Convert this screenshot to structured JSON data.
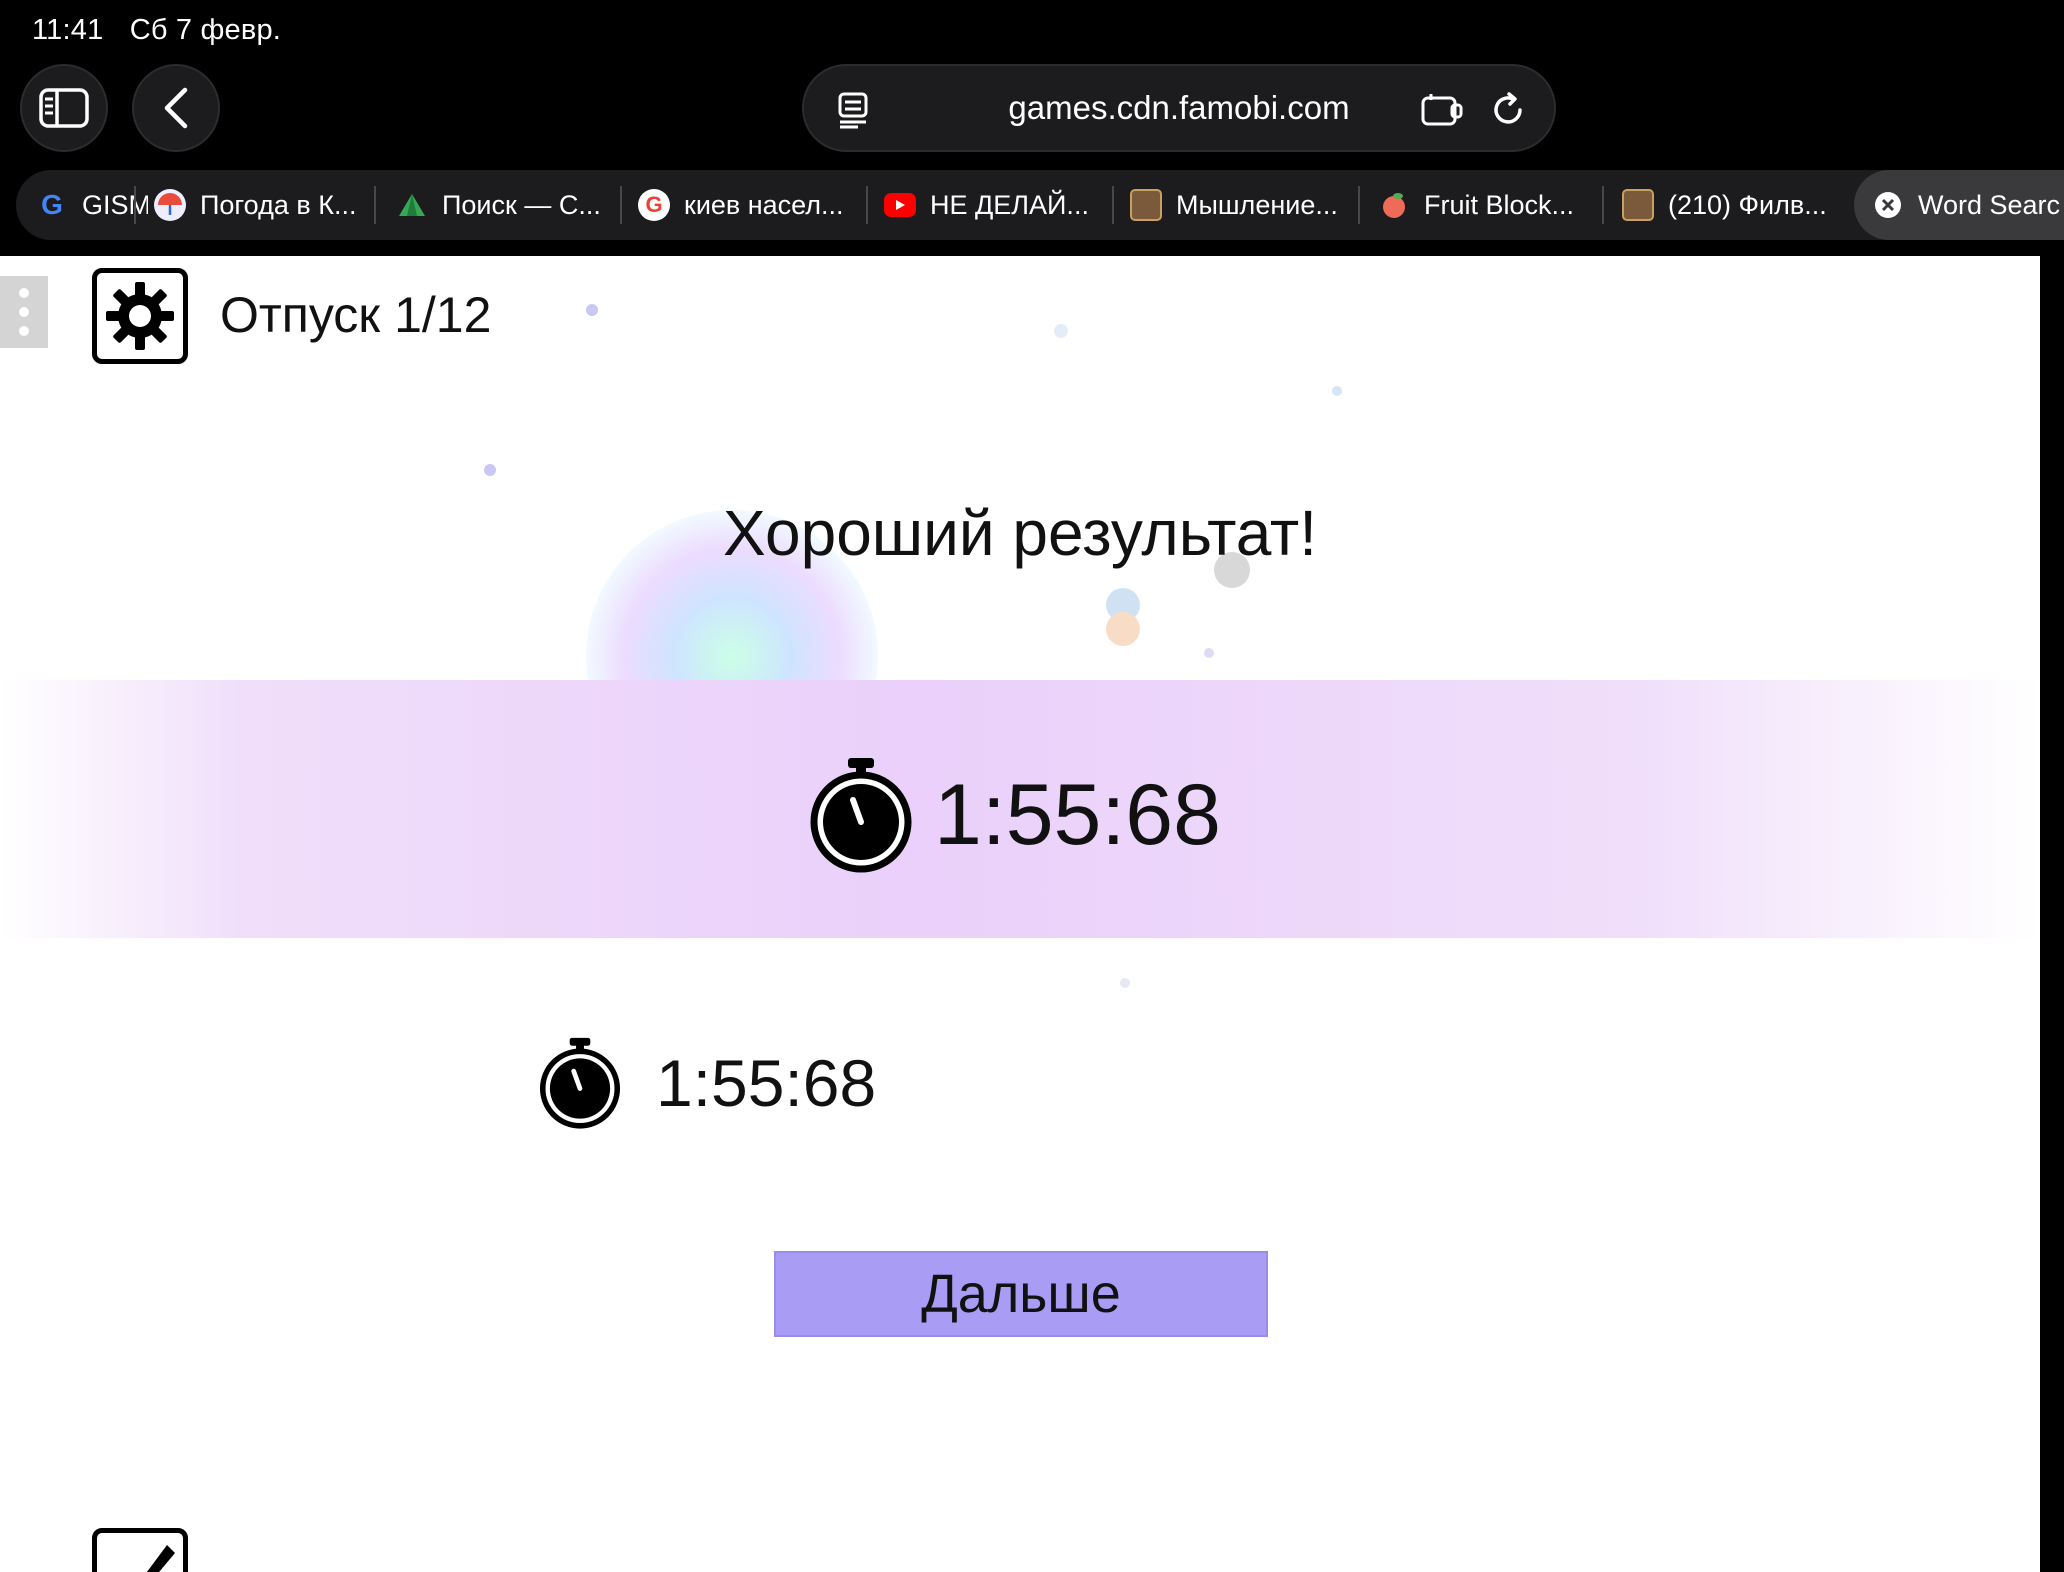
{
  "status_bar": {
    "time": "11:41",
    "date": "Сб 7 февр."
  },
  "browser": {
    "url": "games.cdn.famobi.com",
    "tabs": [
      {
        "label": "GISM",
        "icon": "google-g-icon",
        "color": "#4285f4"
      },
      {
        "label": "Погода в К...",
        "icon": "umbrella-icon",
        "color": "#e94b3c"
      },
      {
        "label": "Поиск — С...",
        "icon": "pyramid-icon",
        "color": "#34a853"
      },
      {
        "label": "киев насел...",
        "icon": "google-icon",
        "color": "#ea4335"
      },
      {
        "label": "НЕ ДЕЛАЙ...",
        "icon": "youtube-icon",
        "color": "#ff0000"
      },
      {
        "label": "Мышление...",
        "icon": "book-cover-icon",
        "color": "#7a5a3a"
      },
      {
        "label": "Fruit Block...",
        "icon": "peach-icon",
        "color": "#f06a5a"
      },
      {
        "label": "(210) Филв...",
        "icon": "book-cover-icon",
        "color": "#7a5a3a"
      },
      {
        "label": "Word Searc",
        "icon": "close-circle-icon",
        "color": "#ffffff"
      }
    ]
  },
  "game": {
    "level_label": "Отпуск 1/12",
    "result_title": "Хороший результат!",
    "current_time": "1:55:68",
    "best_time": "1:55:68",
    "next_button": "Дальше",
    "accent_color": "#a89cf4"
  }
}
